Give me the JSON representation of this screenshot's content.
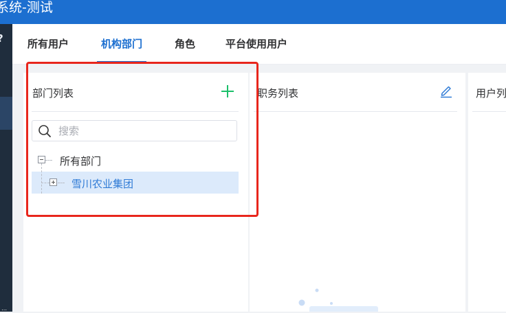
{
  "header": {
    "title": "系统-测试"
  },
  "sidebar": {
    "glyph": "?",
    "dots": "⋯"
  },
  "tabs": [
    {
      "label": "所有用户",
      "active": false
    },
    {
      "label": "机构部门",
      "active": true
    },
    {
      "label": "角色",
      "active": false
    },
    {
      "label": "平台使用用户",
      "active": false
    }
  ],
  "dept_panel": {
    "title": "部门列表",
    "add_icon": "plus-icon",
    "search": {
      "placeholder": "搜索",
      "value": ""
    },
    "tree": {
      "root": {
        "label": "所有部门",
        "expanded": true
      },
      "children": [
        {
          "label": "雪川农业集团",
          "expanded": false,
          "selected": true
        }
      ]
    }
  },
  "job_panel": {
    "title": "职务列表",
    "edit_icon": "edit-icon"
  },
  "user_panel": {
    "title": "用户列"
  },
  "colors": {
    "primary": "#1c6fd0",
    "add": "#1bbf6a",
    "selected_bg": "#dceafb",
    "annotation": "#e8261c"
  }
}
